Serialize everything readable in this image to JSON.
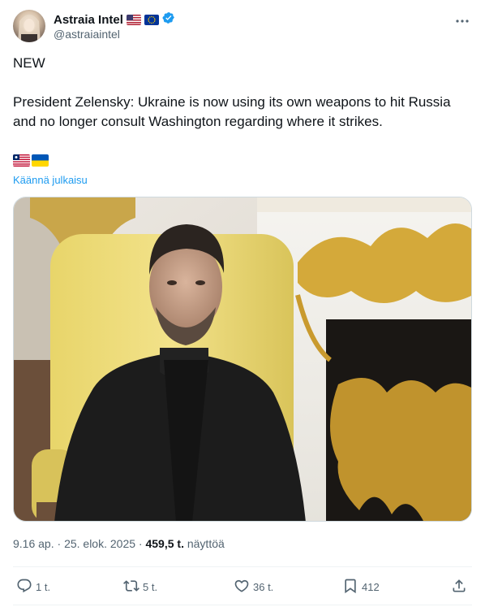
{
  "author": {
    "display_name": "Astraia Intel",
    "handle": "@astraiaintel",
    "flags": [
      "us-flag-icon",
      "eu-flag-icon"
    ],
    "verified": true
  },
  "post": {
    "text": "NEW\n\nPresident Zelensky: Ukraine is now using its own weapons to hit Russia and no longer consult Washington regarding where it strikes.",
    "emoji_flags": [
      "liberia-flag-icon",
      "ukraine-flag-icon"
    ],
    "translate_label": "Käännä julkaisu"
  },
  "meta": {
    "time": "9.16 ap.",
    "date": "25. elok. 2025",
    "dot": "·",
    "views_count": "459,5 t.",
    "views_label": "näyttöä"
  },
  "actions": {
    "replies": "1 t.",
    "reposts": "5 t.",
    "likes": "36 t.",
    "bookmarks": "412"
  },
  "colors": {
    "accent": "#1d9bf0",
    "secondary_text": "#536471",
    "primary_text": "#0f1419"
  }
}
